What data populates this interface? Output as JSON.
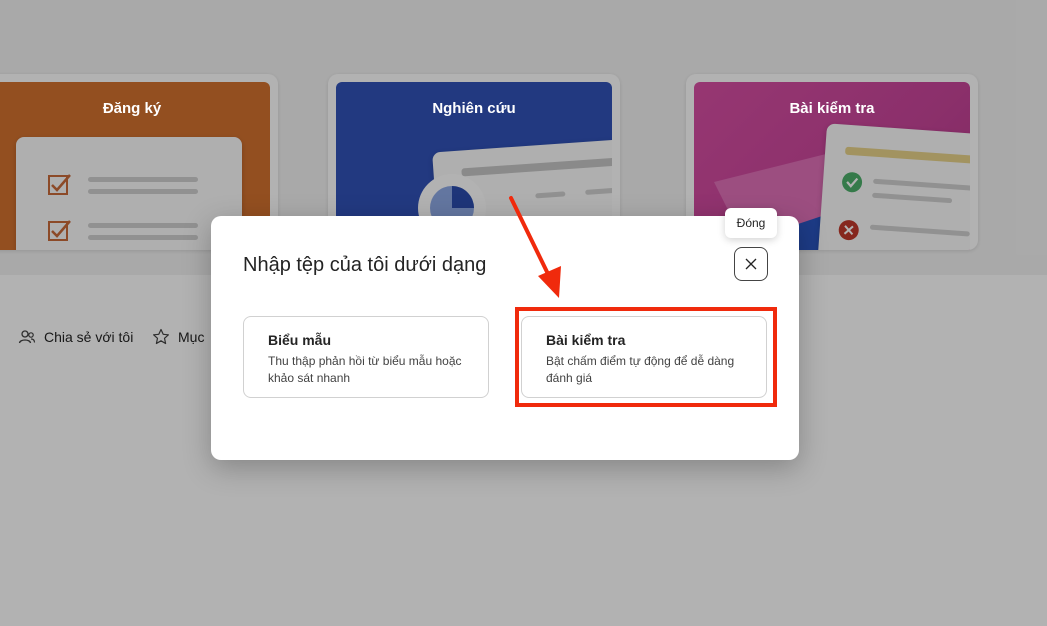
{
  "templates": [
    {
      "label": "Đăng ký"
    },
    {
      "label": "Nghiên cứu"
    },
    {
      "label": "Bài kiểm tra"
    }
  ],
  "nav": {
    "shared": "Chia sẻ với tôi",
    "favorites": "Mục"
  },
  "dialog": {
    "title": "Nhập tệp của tôi dưới dạng",
    "close_tooltip": "Đóng",
    "options": [
      {
        "title": "Biểu mẫu",
        "description": "Thu thập phản hồi từ biểu mẫu hoặc khảo sát nhanh"
      },
      {
        "title": "Bài kiểm tra",
        "description": "Bật chấm điểm tự động để dễ dàng đánh giá"
      }
    ]
  },
  "colors": {
    "highlight": "#f02a0c",
    "dangky": "#d3722f",
    "nghiencuu": "#3152b8",
    "baikiemtra": "#d84fa4"
  }
}
